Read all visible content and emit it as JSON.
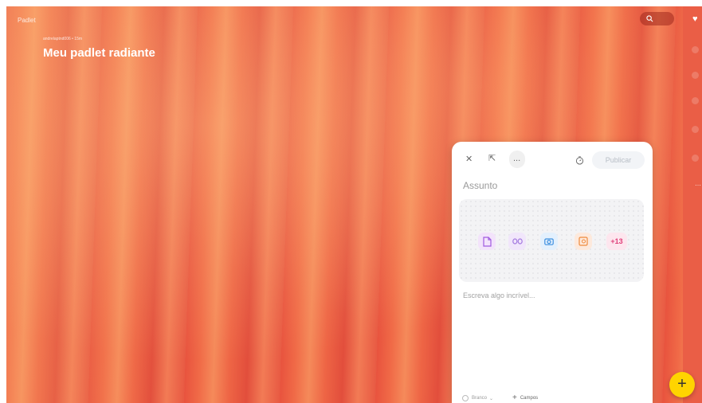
{
  "app": {
    "logo_text": "Padlet"
  },
  "board": {
    "author_line": "andrelaptnd006 • 15m",
    "title": "Meu padlet radiante"
  },
  "composer": {
    "publish_label": "Publicar",
    "subject_placeholder": "Assunto",
    "body_placeholder": "Escreva algo incrível...",
    "attachments": [
      {
        "name": "file-upload-icon"
      },
      {
        "name": "link-icon"
      },
      {
        "name": "camera-icon"
      },
      {
        "name": "image-search-icon"
      },
      {
        "label": "+13"
      }
    ],
    "more_label": "...",
    "color_label": "Branco",
    "fields_label": "Campos"
  },
  "colors": {
    "accent_fab": "#ffd400",
    "board_base": "#ee6545"
  },
  "fab": {
    "label": "+"
  }
}
